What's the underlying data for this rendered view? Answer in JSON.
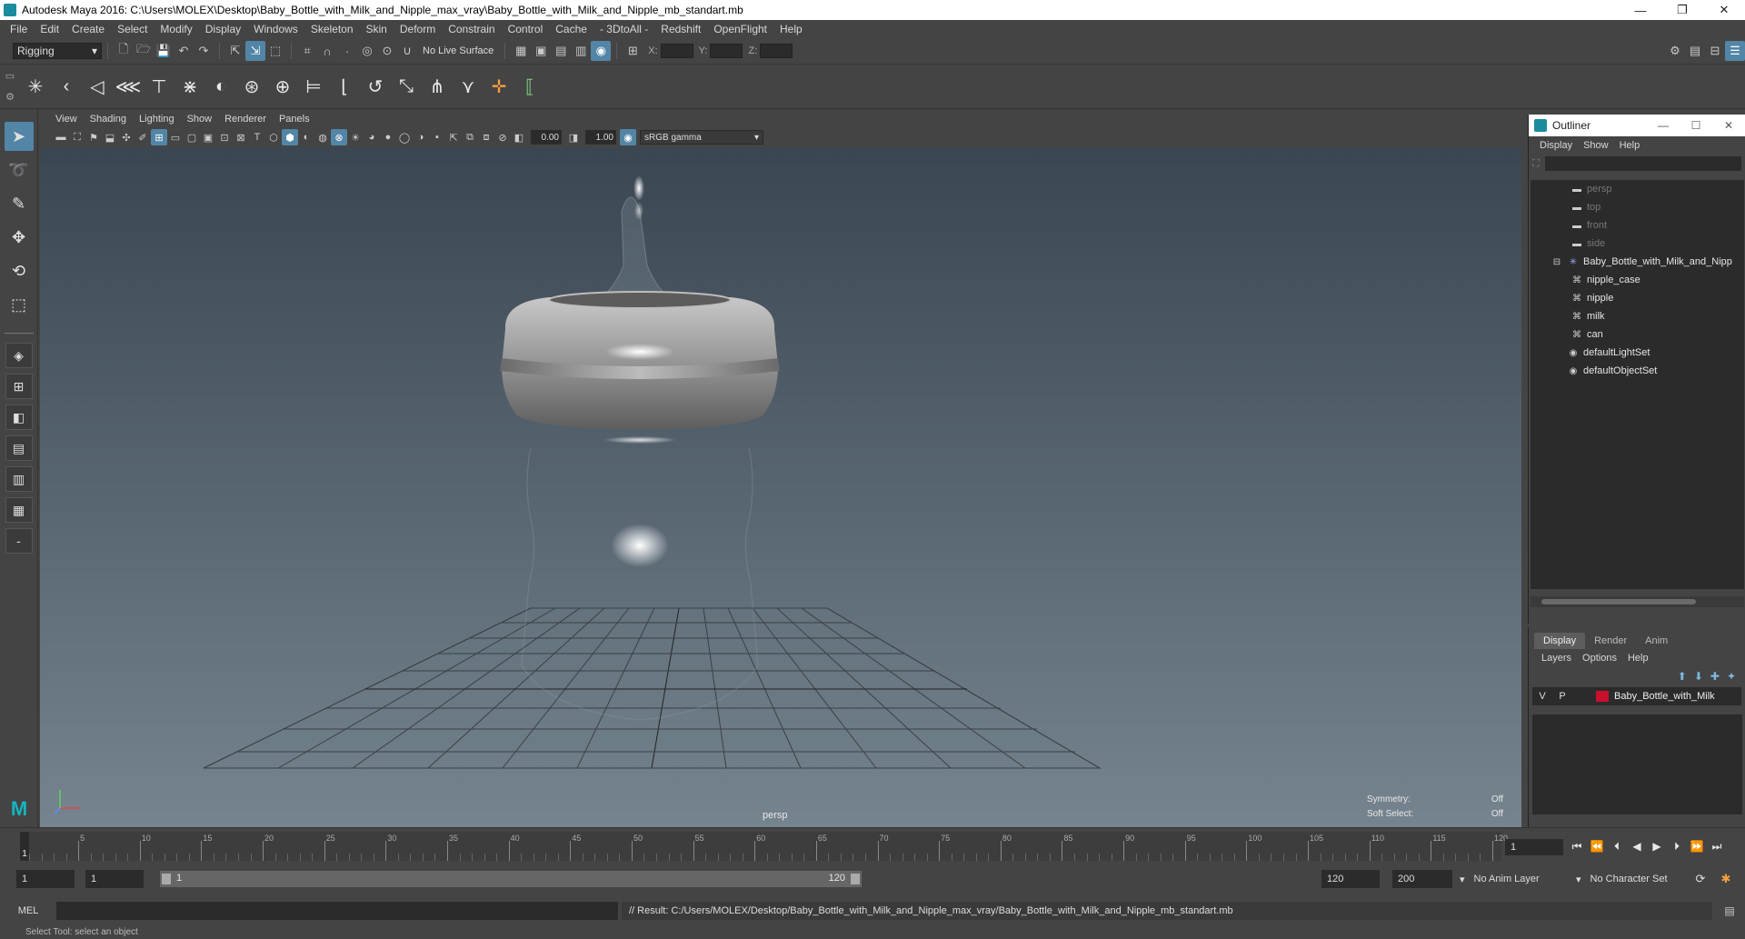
{
  "window": {
    "title": "Autodesk Maya 2016: C:\\Users\\MOLEX\\Desktop\\Baby_Bottle_with_Milk_and_Nipple_max_vray\\Baby_Bottle_with_Milk_and_Nipple_mb_standart.mb",
    "minimize": "—",
    "restore": "❐",
    "close": "✕"
  },
  "menubar": [
    "File",
    "Edit",
    "Create",
    "Select",
    "Modify",
    "Display",
    "Windows",
    "Skeleton",
    "Skin",
    "Deform",
    "Constrain",
    "Control",
    "Cache",
    "- 3DtoAll -",
    "Redshift",
    "OpenFlight",
    "Help"
  ],
  "statusline": {
    "mode": "Rigging",
    "live_surface": "No Live Surface",
    "x_label": "X:",
    "y_label": "Y:",
    "z_label": "Z:"
  },
  "panel": {
    "menus": [
      "View",
      "Shading",
      "Lighting",
      "Show",
      "Renderer",
      "Panels"
    ],
    "exposure": "0.00",
    "gamma": "1.00",
    "color_space": "sRGB gamma"
  },
  "viewport": {
    "camera": "persp",
    "symmetry_label": "Symmetry:",
    "symmetry_value": "Off",
    "soft_select_label": "Soft Select:",
    "soft_select_value": "Off"
  },
  "outliner": {
    "title": "Outliner",
    "menus": [
      "Display",
      "Show",
      "Help"
    ],
    "items": [
      {
        "label": "persp",
        "icon": "camera-icon",
        "indent": 0,
        "dim": true
      },
      {
        "label": "top",
        "icon": "camera-icon",
        "indent": 0,
        "dim": true
      },
      {
        "label": "front",
        "icon": "camera-icon",
        "indent": 0,
        "dim": true
      },
      {
        "label": "side",
        "icon": "camera-icon",
        "indent": 0,
        "dim": true
      },
      {
        "label": "Baby_Bottle_with_Milk_and_Nipp",
        "icon": "group-icon",
        "indent": 0,
        "dim": false
      },
      {
        "label": "nipple_case",
        "icon": "mesh-icon",
        "indent": 1,
        "dim": false
      },
      {
        "label": "nipple",
        "icon": "mesh-icon",
        "indent": 1,
        "dim": false
      },
      {
        "label": "milk",
        "icon": "mesh-icon",
        "indent": 1,
        "dim": false
      },
      {
        "label": "can",
        "icon": "mesh-icon",
        "indent": 1,
        "dim": false
      },
      {
        "label": "defaultLightSet",
        "icon": "set-icon",
        "indent": 0,
        "dim": false
      },
      {
        "label": "defaultObjectSet",
        "icon": "set-icon",
        "indent": 0,
        "dim": false
      }
    ]
  },
  "layers": {
    "tabs": [
      "Display",
      "Render",
      "Anim"
    ],
    "active_tab": "Display",
    "menus": [
      "Layers",
      "Options",
      "Help"
    ],
    "rows": [
      {
        "v": "V",
        "p": "P",
        "color": "#c8102e",
        "name": "Baby_Bottle_with_Milk"
      }
    ]
  },
  "timeline": {
    "ticks": [
      "5",
      "10",
      "15",
      "20",
      "25",
      "30",
      "35",
      "40",
      "45",
      "50",
      "55",
      "60",
      "65",
      "70",
      "75",
      "80",
      "85",
      "90",
      "95",
      "100",
      "105",
      "110",
      "115",
      "120"
    ],
    "start": 1,
    "end": 120,
    "current_frame_marker": "1",
    "current_frame": "1"
  },
  "range": {
    "start": "1",
    "playback_start": "1",
    "bar_start": "1",
    "bar_end": "120",
    "playback_end": "120",
    "end": "200",
    "anim_layer": "No Anim Layer",
    "character_set": "No Character Set"
  },
  "command": {
    "mode": "MEL",
    "result": "// Result: C:/Users/MOLEX/Desktop/Baby_Bottle_with_Milk_and_Nipple_max_vray/Baby_Bottle_with_Milk_and_Nipple_mb_standart.mb"
  },
  "helpline": "Select Tool: select an object"
}
